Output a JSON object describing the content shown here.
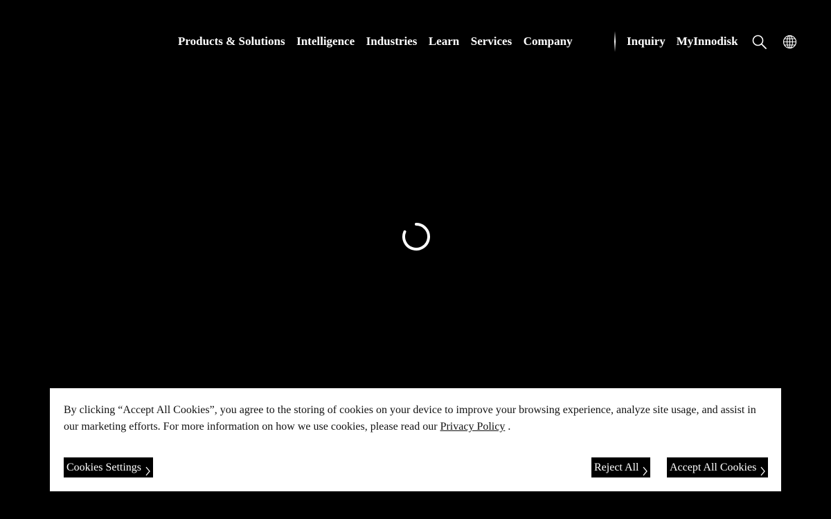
{
  "nav": {
    "main_items": [
      {
        "label": "Products & Solutions"
      },
      {
        "label": "Intelligence"
      },
      {
        "label": "Industries"
      },
      {
        "label": "Learn"
      },
      {
        "label": "Services"
      },
      {
        "label": "Company"
      }
    ],
    "right_items": [
      {
        "label": "Inquiry"
      },
      {
        "label": "MyInnodisk"
      }
    ],
    "icons": {
      "search": "search-icon",
      "language": "globe-icon"
    }
  },
  "loading": {
    "icon": "spinner-icon"
  },
  "cookie_banner": {
    "text_before": "By clicking “Accept All Cookies”, you agree to the storing of cookies on your device to improve your browsing experience, analyze site usage, and assist in our marketing efforts. For more information on how we use cookies, please read our ",
    "privacy_link": "Privacy Policy",
    "text_after": " .",
    "settings_label": "Cookies Settings",
    "reject_label": "Reject All",
    "accept_label": "Accept All Cookies"
  },
  "colors": {
    "background": "#000000",
    "banner_background": "#ffffff",
    "button_background": "#000000",
    "nav_text": "#ffffff"
  }
}
